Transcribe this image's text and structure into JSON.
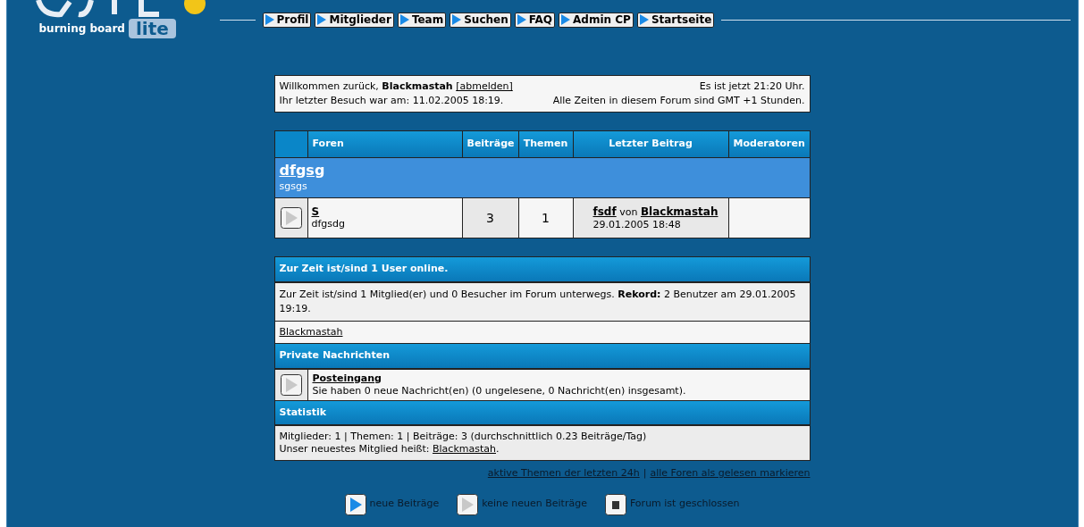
{
  "logo": {
    "subtitle": "burning board",
    "edition": "lite"
  },
  "nav": [
    {
      "label": "Profil"
    },
    {
      "label": "Mitglieder"
    },
    {
      "label": "Team"
    },
    {
      "label": "Suchen"
    },
    {
      "label": "FAQ"
    },
    {
      "label": "Admin CP"
    },
    {
      "label": "Startseite"
    }
  ],
  "welcome": {
    "greeting": "Willkommen zurück,",
    "user": "Blackmastah",
    "logout": "[abmelden]",
    "last_visit": "Ihr letzter Besuch war am: 11.02.2005 18:19.",
    "time": "Es ist jetzt 21:20 Uhr.",
    "timezone": "Alle Zeiten in diesem Forum sind GMT +1 Stunden."
  },
  "forum_table": {
    "columns": [
      "Foren",
      "Beiträge",
      "Themen",
      "Letzter Beitrag",
      "Moderatoren"
    ],
    "categories": [
      {
        "title": "dfgsg",
        "description": "sgsgs",
        "forums": [
          {
            "name": "S",
            "description": "dfgsdg",
            "new_posts": false,
            "posts": "3",
            "topics": "1",
            "last_post": {
              "title": "fsdf",
              "by": "von",
              "author": "Blackmastah",
              "date": "29.01.2005 18:48"
            }
          }
        ]
      }
    ]
  },
  "online": {
    "title": "Zur Zeit ist/sind 1 User online.",
    "text": "Zur Zeit ist/sind 1 Mitglied(er) und 0 Besucher im Forum unterwegs. **Rekord:** 2 Benutzer am 29.01.2005 19:19.",
    "users": [
      "Blackmastah"
    ]
  },
  "messages": {
    "title": "Private Nachrichten",
    "inbox": "Posteingang",
    "new_messages": false,
    "text": "Sie haben 0 neue Nachricht(en) (0 ungelesene, 0 Nachricht(en) insgesamt)."
  },
  "stats": {
    "title": "Statistik",
    "line": "Mitglieder: 1 | Themen: 1 | Beiträge: 3 (durchschnittlich 0.23 Beiträge/Tag)",
    "newest_prefix": "Unser neuestes Mitglied heißt:",
    "newest_user": "Blackmastah",
    "newest_suffix": "."
  },
  "footer_links": [
    {
      "label": "aktive Themen der letzten 24h"
    },
    {
      "label": "alle Foren als gelesen markieren"
    }
  ],
  "footer_separator": "|",
  "legend": [
    {
      "kind": "new",
      "label": "neue Beiträge"
    },
    {
      "kind": "none",
      "label": "keine neuen Beiträge"
    },
    {
      "kind": "closed",
      "label": "Forum ist geschlossen"
    }
  ]
}
